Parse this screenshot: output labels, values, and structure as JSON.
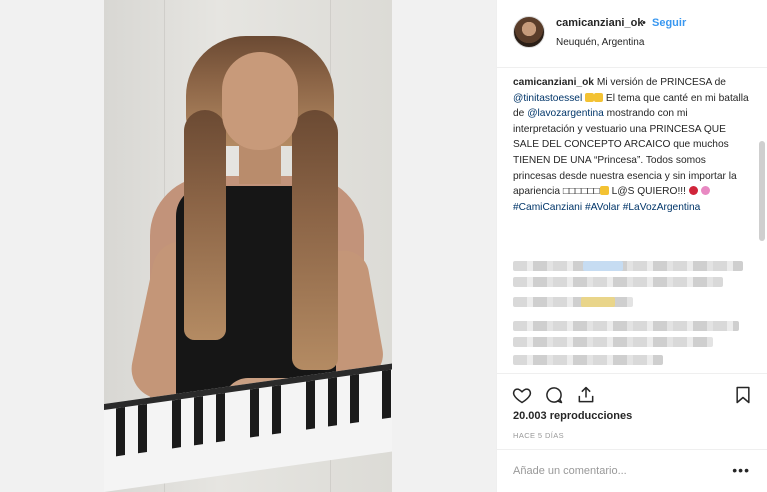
{
  "post": {
    "username": "camicanziani_ok",
    "separator": "•",
    "follow_label": "Seguir",
    "location": "Neuquén, Argentina"
  },
  "caption": {
    "username": "camicanziani_ok",
    "text_1": "Mi versión de PRINCESA de",
    "mention_1": "@tinitastoessel",
    "text_2": "El tema que canté en mi batalla de",
    "mention_2": "@lavozargentina",
    "text_3": "mostrando con mi interpretación y vestuario una PRINCESA QUE SALE DEL CONCEPTO ARCAICO que muchos TIENEN DE UNA “Princesa”. Todos somos princesas desde nuestra esencia y sin importar la apariencia",
    "symbols": "□□□□□□",
    "text_4": "L@S QUIERO!!!",
    "hashtags": [
      "#CamiCanziani",
      "#AVolar",
      "#LaVozArgentina"
    ]
  },
  "stats": {
    "views": "20.003 reproducciones",
    "time_ago": "HACE 5 DÍAS"
  },
  "comment": {
    "placeholder": "Añade un comentario...",
    "more_label": "•••"
  },
  "icons": {
    "like": "heart-icon",
    "comment": "comment-icon",
    "share": "share-icon",
    "save": "bookmark-icon"
  },
  "colors": {
    "link": "#003569",
    "follow": "#3897f0",
    "text": "#262626",
    "muted": "#999999"
  }
}
